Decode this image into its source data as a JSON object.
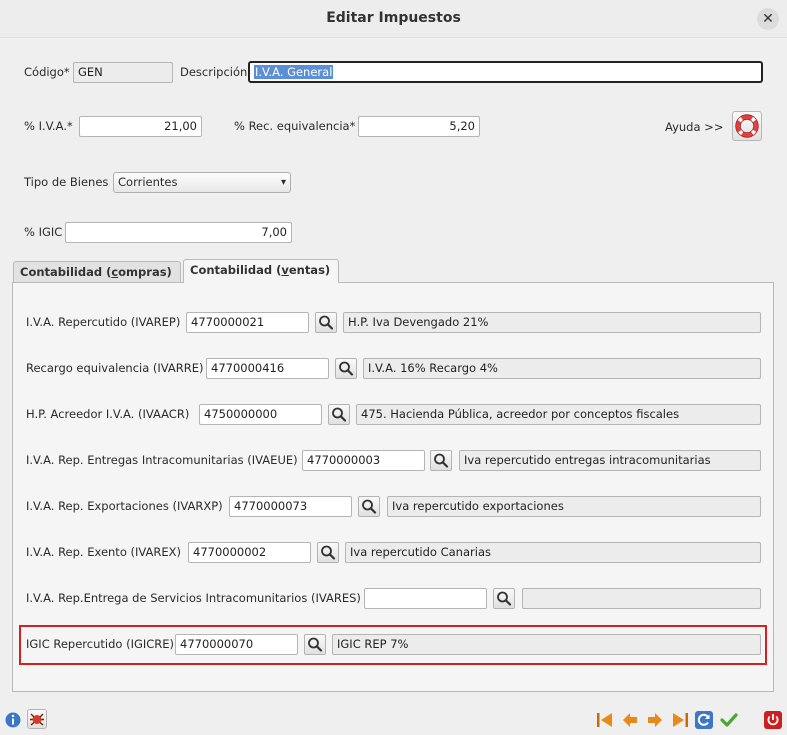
{
  "window": {
    "title": "Editar Impuestos",
    "close_glyph": "✕"
  },
  "form": {
    "codigo_label": "Código*",
    "codigo_value": "GEN",
    "descripcion_label": "Descripción",
    "descripcion_value": "I.V.A. General",
    "iva_label": "% I.V.A.*",
    "iva_value": "21,00",
    "rec_label": "% Rec. equivalencia*",
    "rec_value": "5,20",
    "ayuda_label": "Ayuda >>",
    "tipo_bienes_label": "Tipo de Bienes",
    "tipo_bienes_value": "Corrientes",
    "igic_label": "% IGIC",
    "igic_value": "7,00"
  },
  "tabs": {
    "compras": {
      "pre": "Contabilidad (",
      "key": "c",
      "post": "ompras)"
    },
    "ventas": {
      "pre": "Contabilidad (",
      "key": "v",
      "post": "entas)"
    }
  },
  "accounts": [
    {
      "label": "I.V.A. Repercutido (IVAREP)",
      "code": "4770000021",
      "desc": "H.P. Iva Devengado 21%"
    },
    {
      "label": "Recargo equivalencia (IVARRE)",
      "code": "4770000416",
      "desc": "I.V.A. 16% Recargo 4%"
    },
    {
      "label": "H.P. Acreedor I.V.A. (IVAACR)",
      "code": "4750000000",
      "desc": "475. Hacienda Pública, acreedor por conceptos fiscales"
    },
    {
      "label": "I.V.A. Rep. Entregas Intracomunitarias (IVAEUE)",
      "code": "4770000003",
      "desc": "Iva repercutido entregas intracomunitarias"
    },
    {
      "label": "I.V.A. Rep. Exportaciones (IVARXP)",
      "code": "4770000073",
      "desc": "Iva repercutido exportaciones"
    },
    {
      "label": "I.V.A. Rep. Exento (IVAREX)",
      "code": "4770000002",
      "desc": "Iva repercutido Canarias"
    },
    {
      "label": "I.V.A. Rep.Entrega de Servicios Intracomunitarios (IVARES)",
      "code": "",
      "desc": ""
    },
    {
      "label": "IGIC Repercutido (IGICRE)",
      "code": "4770000070",
      "desc": "IGIC REP 7%"
    }
  ],
  "colors": {
    "highlight": "#d42020",
    "selection": "#5b8fd6",
    "accept": "#4aa832",
    "nav_orange": "#e88a1a",
    "exit_red": "#cc1f1f"
  }
}
